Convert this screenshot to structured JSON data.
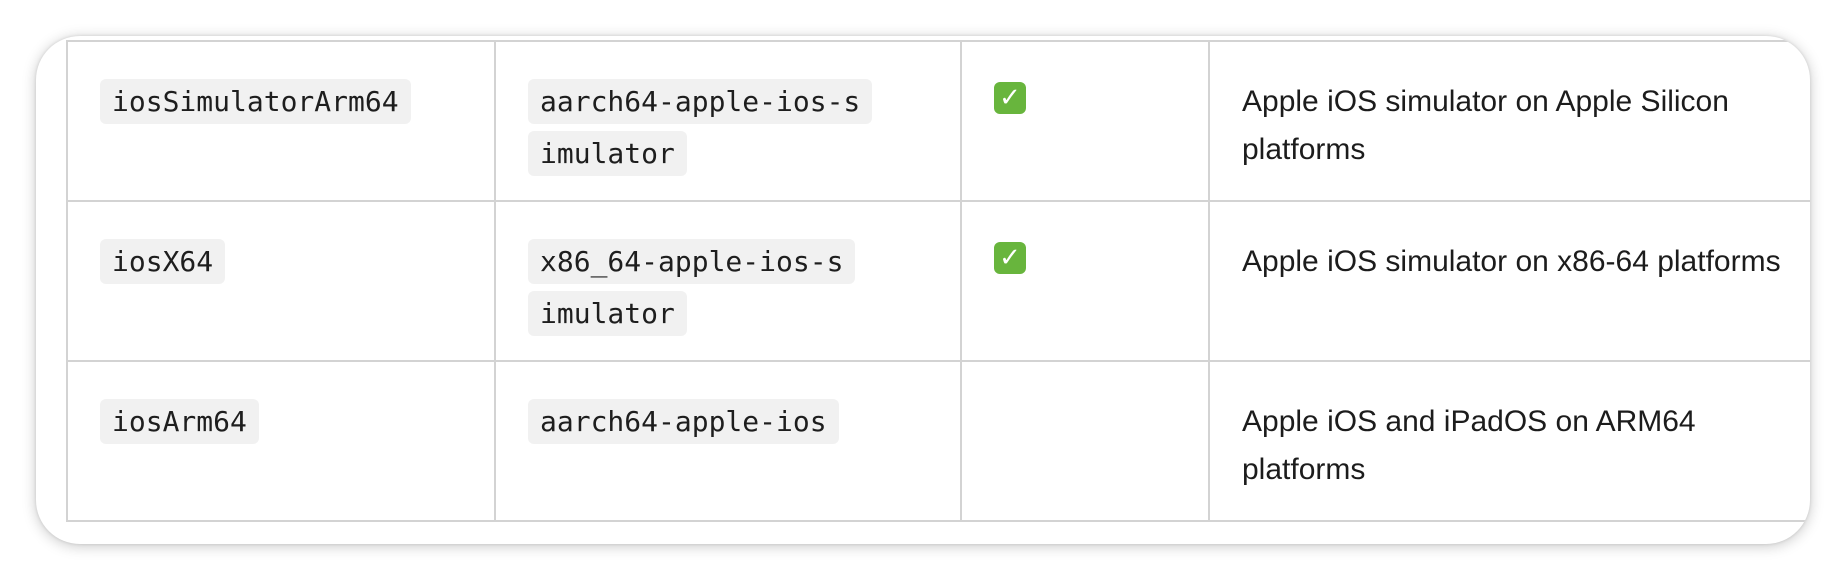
{
  "rows": [
    {
      "target": "iosSimulatorArm64",
      "triple": "aarch64-apple-ios-simulator",
      "check_icon": "check-mark-button-icon",
      "checked": true,
      "description": "Apple iOS simulator on Apple Silicon platforms"
    },
    {
      "target": "iosX64",
      "triple": "x86_64-apple-ios-simulator",
      "check_icon": "check-mark-button-icon",
      "checked": true,
      "description": "Apple iOS simulator on x86-64 platforms"
    },
    {
      "target": "iosArm64",
      "triple": "aarch64-apple-ios",
      "checked": false,
      "description": "Apple iOS and iPadOS on ARM64 platforms"
    }
  ],
  "colors": {
    "check_green": "#68b53d",
    "code_background": "#f1f1f1",
    "border": "#d3d3d3"
  }
}
